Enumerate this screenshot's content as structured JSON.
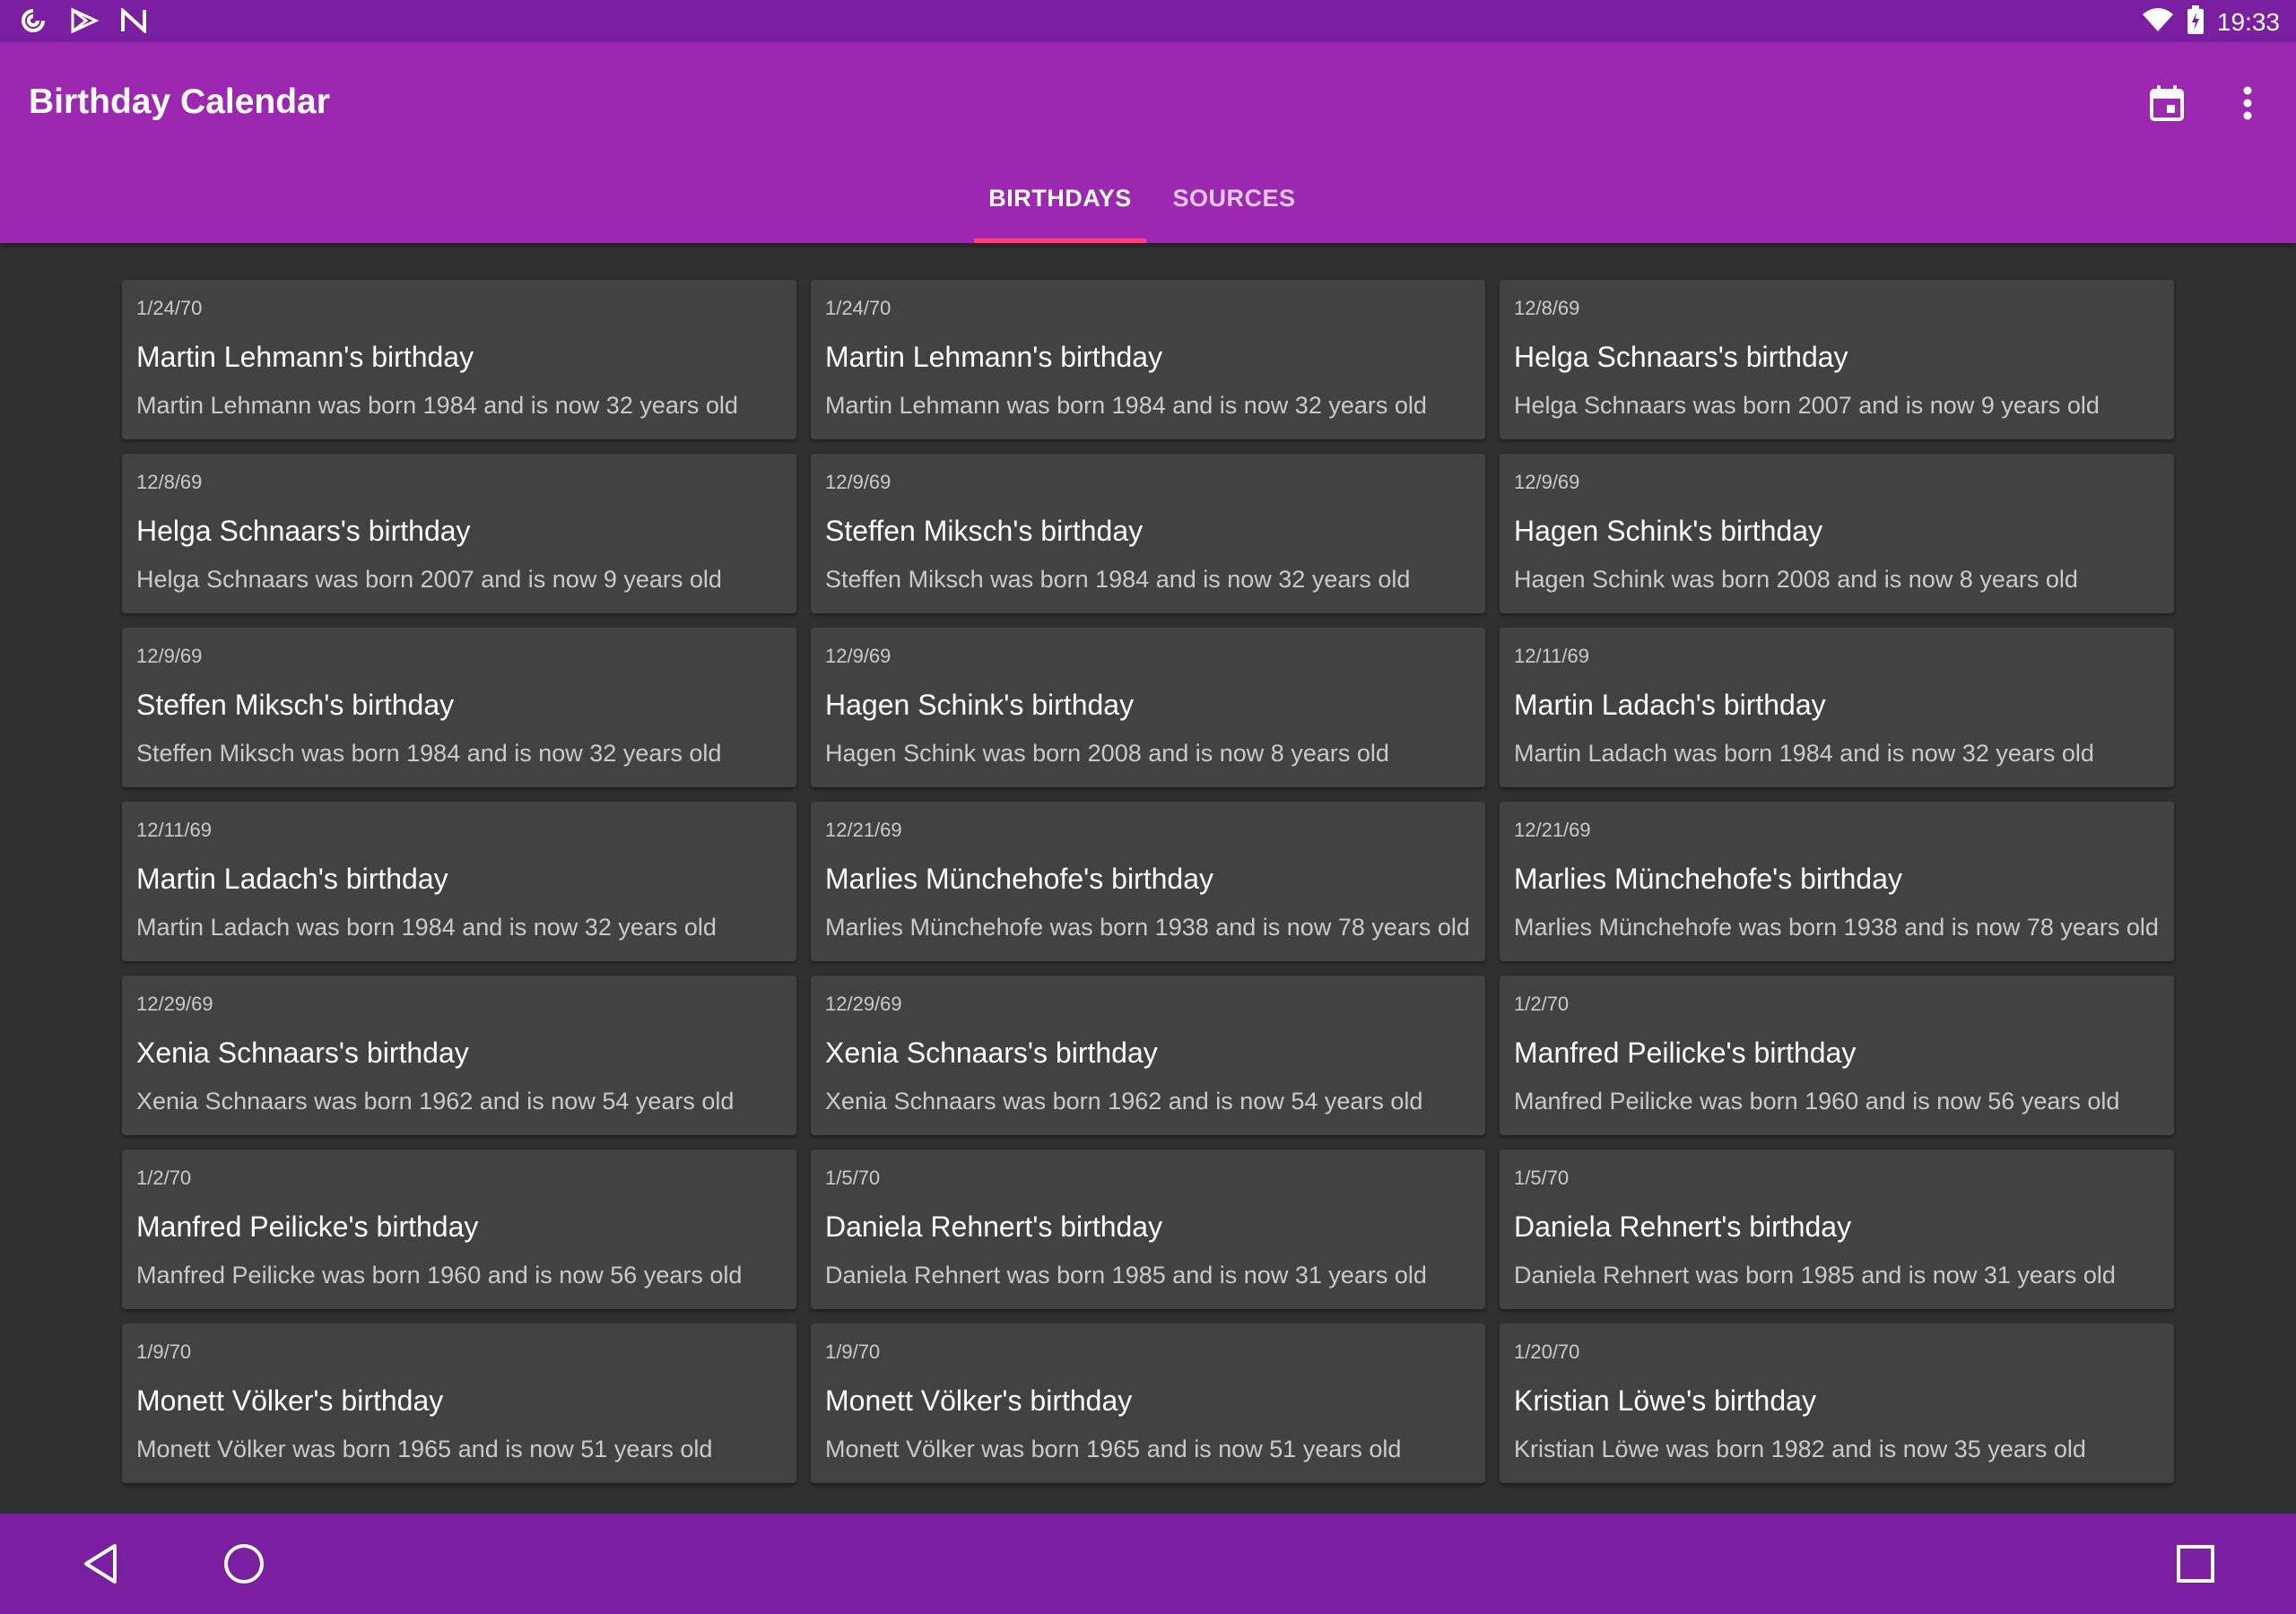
{
  "status_bar": {
    "time": "19:33",
    "left_icons": [
      "sync-icon",
      "play-store-icon",
      "nfc-icon"
    ],
    "right_icons": [
      "wifi-icon",
      "battery-icon"
    ]
  },
  "app_bar": {
    "title": "Birthday Calendar",
    "actions": [
      "calendar-icon",
      "overflow-menu-icon"
    ],
    "color": "#9c27b0",
    "status_color": "#7b1fa2",
    "indicator_color": "#ff4081"
  },
  "tabs": [
    {
      "label": "BIRTHDAYS",
      "active": true
    },
    {
      "label": "SOURCES",
      "active": false
    }
  ],
  "birthdays": [
    {
      "date": "1/24/70",
      "title": "Martin Lehmann's birthday",
      "desc": "Martin Lehmann was born 1984 and is now 32 years old"
    },
    {
      "date": "1/24/70",
      "title": "Martin Lehmann's birthday",
      "desc": "Martin Lehmann was born 1984 and is now 32 years old"
    },
    {
      "date": "12/8/69",
      "title": "Helga Schnaars's birthday",
      "desc": "Helga Schnaars was born 2007 and is now 9 years old"
    },
    {
      "date": "12/8/69",
      "title": "Helga Schnaars's birthday",
      "desc": "Helga Schnaars was born 2007 and is now 9 years old"
    },
    {
      "date": "12/9/69",
      "title": "Steffen Miksch's birthday",
      "desc": "Steffen Miksch was born 1984 and is now 32 years old"
    },
    {
      "date": "12/9/69",
      "title": "Hagen Schink's birthday",
      "desc": "Hagen Schink was born 2008 and is now 8 years old"
    },
    {
      "date": "12/9/69",
      "title": "Steffen Miksch's birthday",
      "desc": "Steffen Miksch was born 1984 and is now 32 years old"
    },
    {
      "date": "12/9/69",
      "title": "Hagen Schink's birthday",
      "desc": "Hagen Schink was born 2008 and is now 8 years old"
    },
    {
      "date": "12/11/69",
      "title": "Martin Ladach's birthday",
      "desc": "Martin Ladach was born 1984 and is now 32 years old"
    },
    {
      "date": "12/11/69",
      "title": "Martin Ladach's birthday",
      "desc": "Martin Ladach was born 1984 and is now 32 years old"
    },
    {
      "date": "12/21/69",
      "title": "Marlies Münchehofe's birthday",
      "desc": "Marlies Münchehofe was born 1938 and is now 78 years old"
    },
    {
      "date": "12/21/69",
      "title": "Marlies Münchehofe's birthday",
      "desc": "Marlies Münchehofe was born 1938 and is now 78 years old"
    },
    {
      "date": "12/29/69",
      "title": "Xenia Schnaars's birthday",
      "desc": "Xenia Schnaars was born 1962 and is now 54 years old"
    },
    {
      "date": "12/29/69",
      "title": "Xenia Schnaars's birthday",
      "desc": "Xenia Schnaars was born 1962 and is now 54 years old"
    },
    {
      "date": "1/2/70",
      "title": "Manfred Peilicke's birthday",
      "desc": "Manfred Peilicke was born 1960 and is now 56 years old"
    },
    {
      "date": "1/2/70",
      "title": "Manfred Peilicke's birthday",
      "desc": "Manfred Peilicke was born 1960 and is now 56 years old"
    },
    {
      "date": "1/5/70",
      "title": "Daniela Rehnert's birthday",
      "desc": "Daniela Rehnert was born 1985 and is now 31 years old"
    },
    {
      "date": "1/5/70",
      "title": "Daniela Rehnert's birthday",
      "desc": "Daniela Rehnert was born 1985 and is now 31 years old"
    },
    {
      "date": "1/9/70",
      "title": "Monett Völker's birthday",
      "desc": "Monett Völker was born 1965 and is now 51 years old"
    },
    {
      "date": "1/9/70",
      "title": "Monett Völker's birthday",
      "desc": "Monett Völker was born 1965 and is now 51 years old"
    },
    {
      "date": "1/20/70",
      "title": "Kristian Löwe's birthday",
      "desc": "Kristian Löwe was born 1982 and is now 35 years old"
    }
  ],
  "nav_bar": {
    "buttons": [
      "back-icon",
      "home-icon",
      "recents-icon"
    ]
  }
}
